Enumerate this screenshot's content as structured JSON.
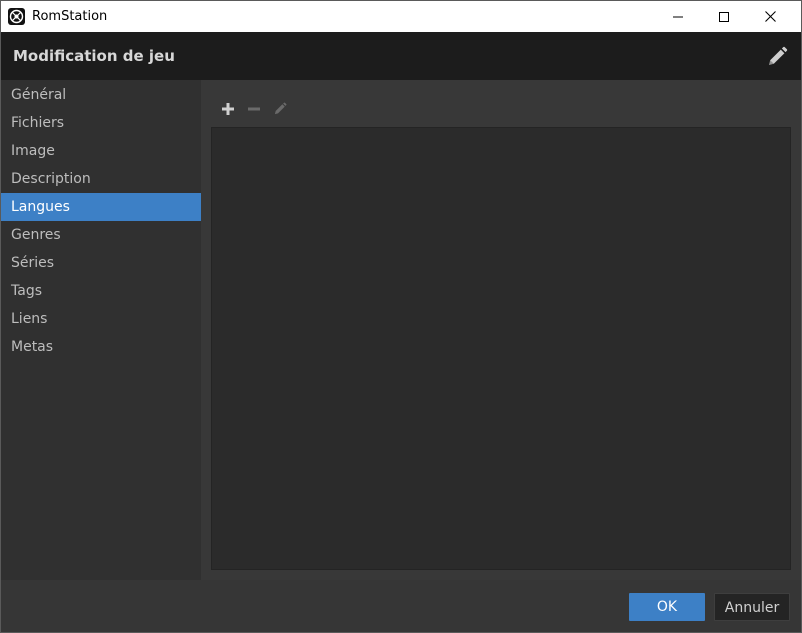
{
  "window": {
    "title": "RomStation",
    "icons": [
      "app-logo-icon",
      "minimize-icon",
      "maximize-icon",
      "close-icon"
    ]
  },
  "header": {
    "title": "Modification de jeu",
    "edit_icon": "pencil-icon"
  },
  "sidebar": {
    "items": [
      {
        "label": "Général"
      },
      {
        "label": "Fichiers"
      },
      {
        "label": "Image"
      },
      {
        "label": "Description"
      },
      {
        "label": "Langues",
        "active": true
      },
      {
        "label": "Genres"
      },
      {
        "label": "Séries"
      },
      {
        "label": "Tags"
      },
      {
        "label": "Liens"
      },
      {
        "label": "Metas"
      }
    ]
  },
  "toolbar": {
    "icons": [
      "plus-icon",
      "minus-icon",
      "pencil-icon"
    ]
  },
  "footer": {
    "ok_label": "OK",
    "cancel_label": "Annuler"
  },
  "colors": {
    "accent": "#3d80c6",
    "header_bg": "#1c1c1c",
    "panel_bg": "#2b2b2b",
    "sidebar_bg": "#303030"
  }
}
